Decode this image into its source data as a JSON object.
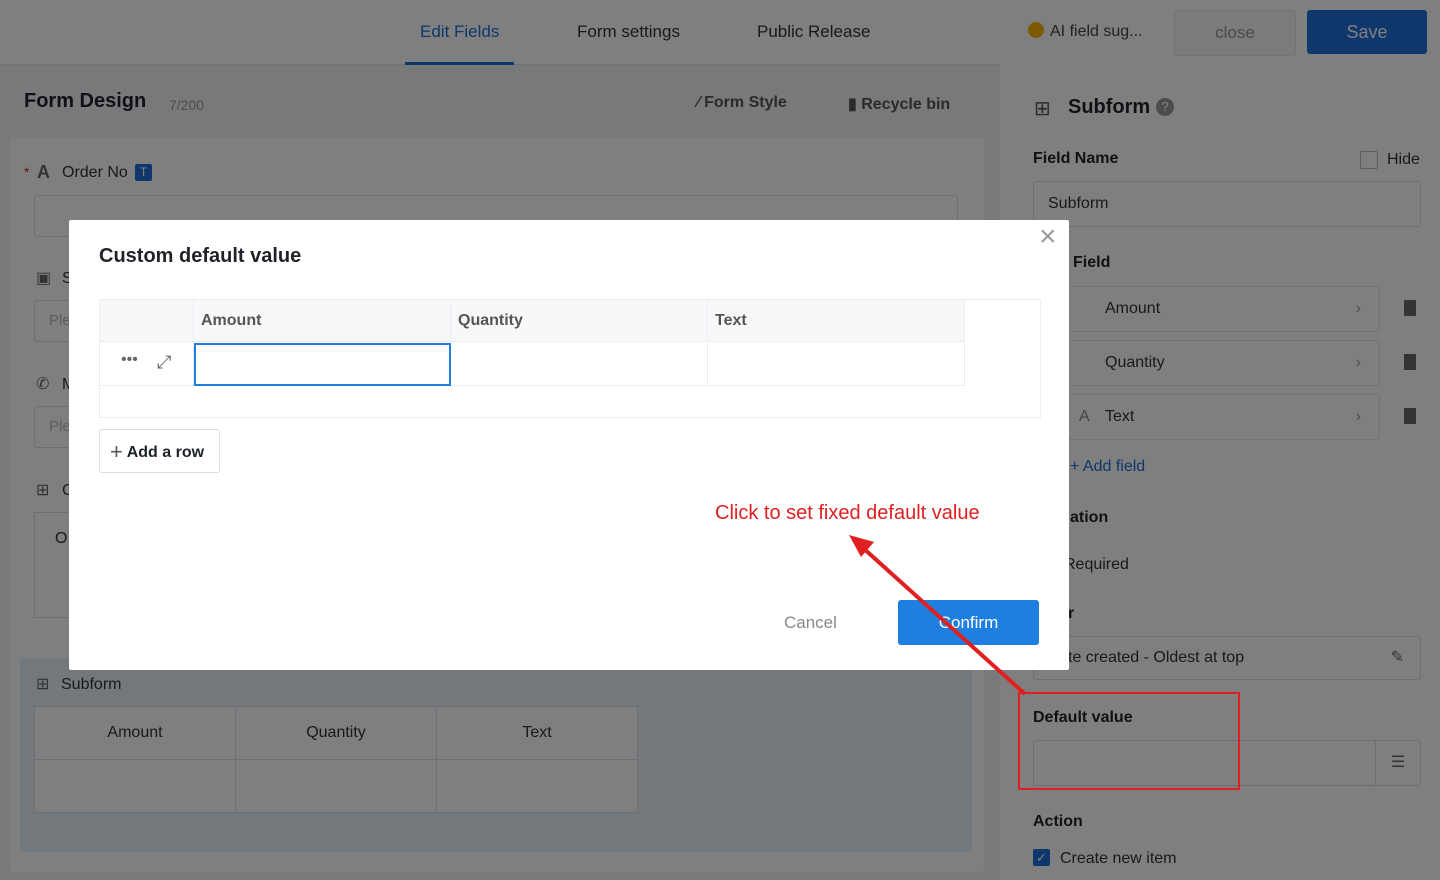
{
  "topbar": {
    "tabs": [
      "Edit Fields",
      "Form settings",
      "Public Release"
    ],
    "ai_suggestion": "AI field sug...",
    "close_label": "close",
    "save_label": "Save"
  },
  "left": {
    "title": "Form Design",
    "count": "7/200",
    "form_style": "Form Style",
    "recycle_bin": "Recycle bin",
    "order_no_label": "Order No",
    "order_no_badge": "T",
    "placeholder_short": "Ple",
    "field_s_partial": "S",
    "field_m_partial": "M",
    "field_c_partial": "C",
    "o_partial": "O",
    "subform_label": "Subform",
    "subform_columns": [
      "Amount",
      "Quantity",
      "Text"
    ]
  },
  "right": {
    "title": "Subform",
    "field_name_label": "Field Name",
    "hide_label": "Hide",
    "field_name_value": "Subform",
    "field_section": "Field",
    "fields": [
      "Amount",
      "Quantity",
      "Text"
    ],
    "add_field": "Add field",
    "validation_partial": "ation",
    "required_partial": "Required",
    "order_partial": "r",
    "sort_partial": "te created - Oldest at top",
    "default_value_label": "Default value",
    "action_label": "Action",
    "create_new_item": "Create new item"
  },
  "modal": {
    "title": "Custom default value",
    "columns": [
      "Amount",
      "Quantity",
      "Text"
    ],
    "add_row": "Add a row",
    "cancel": "Cancel",
    "confirm": "Confirm"
  },
  "annotation": {
    "text": "Click to set fixed default value",
    "color": "#e02020"
  }
}
